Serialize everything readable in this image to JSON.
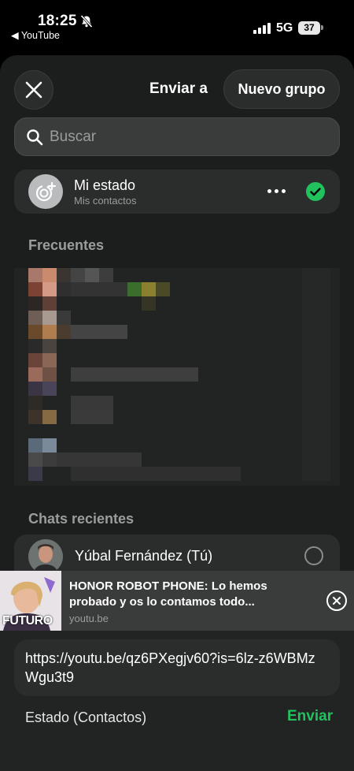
{
  "status_bar": {
    "time": "18:25",
    "back_app": "◀ YouTube",
    "network": "5G",
    "battery": "37"
  },
  "sheet": {
    "title": "Enviar a",
    "new_group": "Nuevo grupo",
    "search_placeholder": "Buscar"
  },
  "my_status": {
    "title": "Mi estado",
    "subtitle": "Mis contactos"
  },
  "sections": {
    "frequent": "Frecuentes",
    "recent_chats": "Chats recientes"
  },
  "recent_chats": [
    {
      "name": "Yúbal Fernández (Tú)"
    }
  ],
  "link_preview": {
    "title": "HONOR ROBOT PHONE: Lo hemos probado y os lo contamos todo...",
    "domain": "youtu.be",
    "thumbnail_text": "FUTURO"
  },
  "message": {
    "text": "https://youtu.be/qz6PXegjv60?is=6lz-z6WBMzWgu3t9"
  },
  "footer": {
    "audience": "Estado (Contactos)",
    "send": "Enviar"
  },
  "colors": {
    "accent_green": "#21c25e",
    "sheet_bg": "#1c1e1d",
    "card_bg": "#2b2d2c"
  }
}
